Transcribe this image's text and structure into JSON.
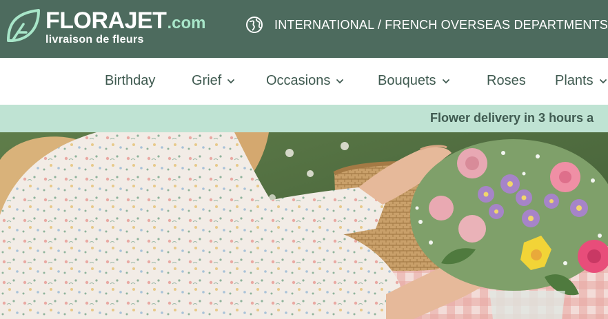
{
  "header": {
    "logo": {
      "brand": "FLORAJET",
      "domain": ".com",
      "tagline": "livraison de fleurs",
      "mark_icon": "leaf-f-icon"
    },
    "region": {
      "icon": "globe-icon",
      "label": "INTERNATIONAL / FRENCH OVERSEAS DEPARTMENTS"
    }
  },
  "nav": {
    "items": [
      {
        "label": "Birthday",
        "has_dropdown": false
      },
      {
        "label": "Grief",
        "has_dropdown": true
      },
      {
        "label": "Occasions",
        "has_dropdown": true
      },
      {
        "label": "Bouquets",
        "has_dropdown": true
      },
      {
        "label": "Roses",
        "has_dropdown": false
      },
      {
        "label": "Plants",
        "has_dropdown": true
      }
    ]
  },
  "promo": {
    "text": "Flower delivery in 3 hours a"
  },
  "hero": {
    "description": "hero-photo"
  },
  "colors": {
    "header_bg": "#4d6b5e",
    "brand_accent": "#a8e6c9",
    "nav_text": "#3f5a50",
    "promo_bg": "#bfe3d3"
  }
}
